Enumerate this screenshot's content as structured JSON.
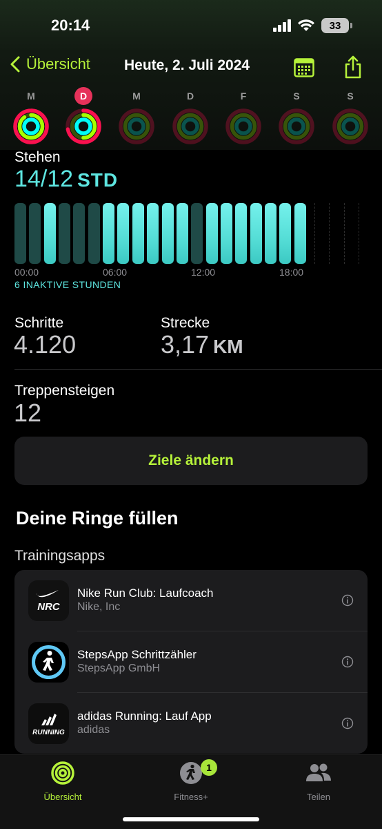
{
  "status": {
    "time": "20:14",
    "battery": "33"
  },
  "nav": {
    "back_label": "Übersicht",
    "title": "Heute, 2. Juli 2024"
  },
  "week": [
    {
      "letter": "M",
      "today": false,
      "move": 0.98,
      "exercise": 0.9,
      "stand": 1.0
    },
    {
      "letter": "D",
      "today": true,
      "move": 0.72,
      "exercise": 0.5,
      "stand": 1.0
    },
    {
      "letter": "M",
      "today": false,
      "move": 0,
      "exercise": 0,
      "stand": 0
    },
    {
      "letter": "D",
      "today": false,
      "move": 0,
      "exercise": 0,
      "stand": 0
    },
    {
      "letter": "F",
      "today": false,
      "move": 0,
      "exercise": 0,
      "stand": 0
    },
    {
      "letter": "S",
      "today": false,
      "move": 0,
      "exercise": 0,
      "stand": 0
    },
    {
      "letter": "S",
      "today": false,
      "move": 0,
      "exercise": 0,
      "stand": 0
    }
  ],
  "stand": {
    "label": "Stehen",
    "value": "14/12",
    "unit": "STD",
    "hours": [
      0,
      0,
      1,
      0,
      0,
      0,
      1,
      1,
      1,
      1,
      1,
      1,
      0,
      1,
      1,
      1,
      1,
      1,
      1,
      1
    ],
    "hour_labels": [
      "00:00",
      "06:00",
      "12:00",
      "18:00"
    ],
    "inactive": "6 INAKTIVE STUNDEN"
  },
  "steps": {
    "label": "Schritte",
    "value": "4.120"
  },
  "distance": {
    "label": "Strecke",
    "value": "3,17",
    "unit": "KM"
  },
  "flights": {
    "label": "Treppensteigen",
    "value": "12"
  },
  "goal_button": "Ziele ändern",
  "rings_section": {
    "title": "Deine Ringe füllen",
    "subtitle": "Trainingsapps"
  },
  "apps": [
    {
      "name": "Nike Run Club: Laufcoach",
      "developer": "Nike, Inc",
      "icon": "nike-run-club-icon",
      "icon_text": "NRC"
    },
    {
      "name": "StepsApp Schrittzähler",
      "developer": "StepsApp GmbH",
      "icon": "stepsapp-icon"
    },
    {
      "name": "adidas Running: Lauf App",
      "developer": "adidas",
      "icon": "adidas-running-icon",
      "icon_text": "RUNNING"
    }
  ],
  "tabs": [
    {
      "label": "Übersicht",
      "active": true,
      "icon": "activity-rings-icon"
    },
    {
      "label": "Fitness+",
      "active": false,
      "icon": "fitness-plus-icon",
      "badge": "1"
    },
    {
      "label": "Teilen",
      "active": false,
      "icon": "people-icon"
    }
  ],
  "colors": {
    "accent": "#b6f23a",
    "stand": "#5ee6e1",
    "move": "#fa114f",
    "exercise": "#a6ff00",
    "stand_ring": "#00fff6",
    "today": "#e6325a"
  }
}
